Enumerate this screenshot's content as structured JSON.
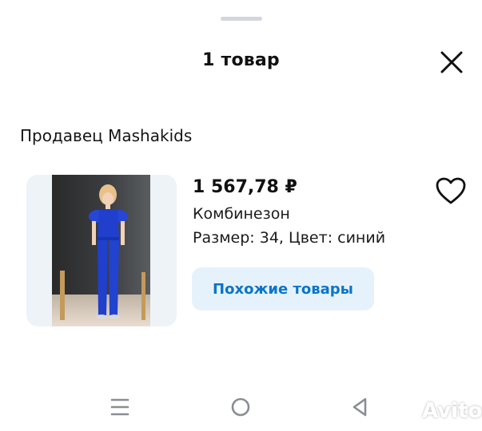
{
  "sheet": {
    "title": "1 товар",
    "close_icon": "close-icon"
  },
  "seller": {
    "label": "Продавец Mashakids"
  },
  "product": {
    "price": "1 567,78 ₽",
    "name": "Комбинезон",
    "attributes": "Размер: 34, Цвет: синий",
    "favorite_icon": "heart-outline-icon",
    "similar_button": "Похожие товары",
    "image_alt": "girl-in-blue-jumpsuit-photo"
  },
  "navbar": {
    "icons": [
      "menu-icon",
      "home-circle-icon",
      "back-triangle-icon"
    ]
  },
  "watermark": {
    "text": "Avito"
  },
  "colors": {
    "accent_text": "#0a75c9",
    "accent_bg": "#e6f2fb",
    "card_bg": "#eef3f8",
    "product_blue": "#1f3fcc"
  }
}
